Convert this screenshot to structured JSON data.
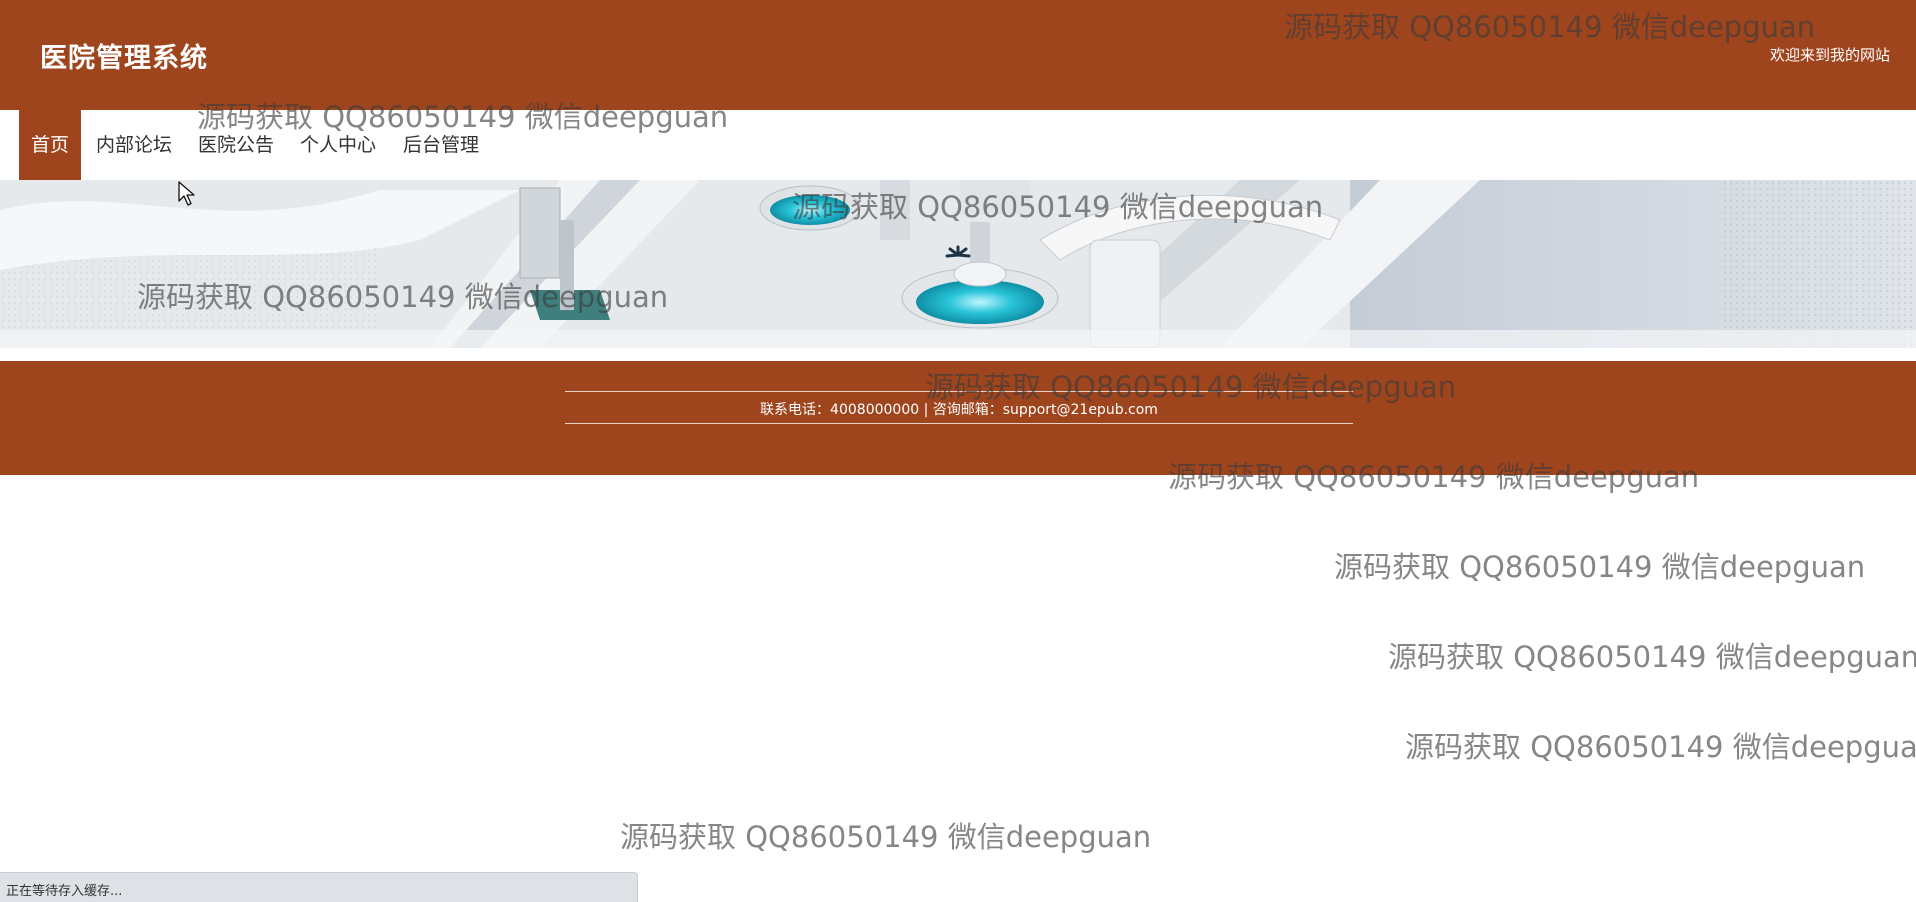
{
  "header": {
    "title": "医院管理系统",
    "welcome": "欢迎来到我的网站"
  },
  "nav": {
    "items": [
      {
        "label": "首页",
        "active": true
      },
      {
        "label": "内部论坛",
        "active": false
      },
      {
        "label": "医院公告",
        "active": false
      },
      {
        "label": "个人中心",
        "active": false
      },
      {
        "label": "后台管理",
        "active": false
      }
    ]
  },
  "footer": {
    "contact": "联系电话：4008000000 | 咨询邮箱：support@21epub.com"
  },
  "watermark": {
    "text": "源码获取 QQ86050149 微信deepguan"
  },
  "status": {
    "text": "正在等待存入缓存..."
  },
  "colors": {
    "brand": "#9f451d",
    "white": "#ffffff"
  },
  "icons": {
    "cursor": "arrow-cursor-icon",
    "loading": "loading-spinner-icon"
  }
}
